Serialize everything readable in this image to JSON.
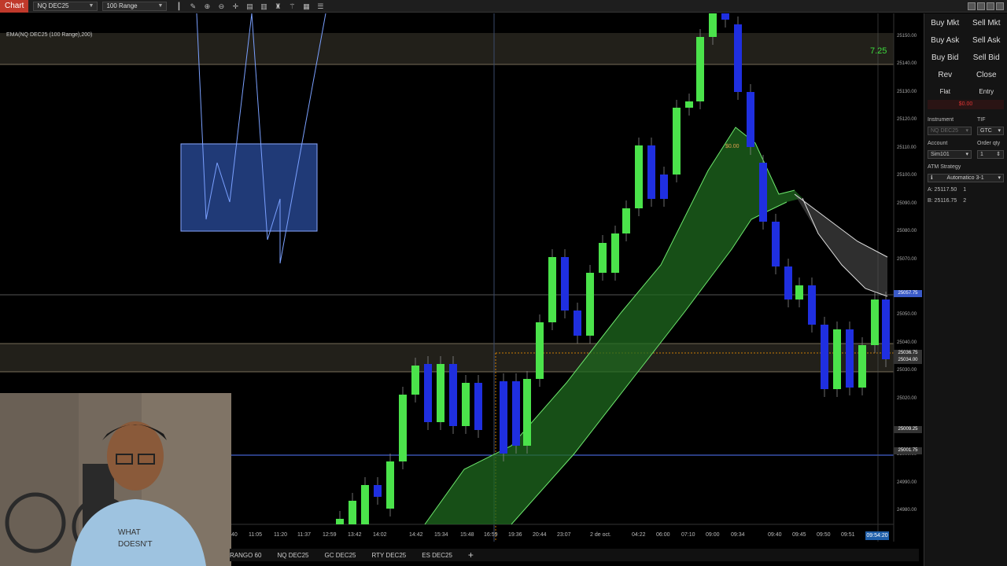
{
  "toolbar": {
    "chart_tab": "Chart",
    "instrument_combo": "NQ DEC25",
    "bar_type_combo": "100 Range",
    "icons": [
      "bar-type-icon",
      "draw-icon",
      "zoom-in-icon",
      "zoom-out-icon",
      "crosshair-icon",
      "properties-icon",
      "templates-icon",
      "strategies-icon",
      "indicators-icon",
      "chart-trader-icon",
      "list-icon"
    ]
  },
  "chart": {
    "indicator_label": "EMA(NQ DEC25 (100 Range),200)",
    "last_tick_countdown": "7.25",
    "price_axis": [
      "25150.00",
      "25140.00",
      "25130.00",
      "25120.00",
      "25110.00",
      "25100.00",
      "25090.00",
      "25080.00",
      "25070.00",
      "25050.00",
      "25040.00",
      "25030.00",
      "25020.00",
      "25000.00",
      "24990.00",
      "24980.00"
    ],
    "price_flags": {
      "current": "25057.75",
      "level_1": "25036.75",
      "level_2": "25034.00",
      "level_3": "25009.25",
      "level_4": "25001.75"
    },
    "time_axis": [
      "40",
      "11:05",
      "11:20",
      "11:37",
      "12:59",
      "13:42",
      "14:02",
      "14:42",
      "15:34",
      "15:48",
      "16:59",
      "19:36",
      "20:44",
      "23:07",
      "2 de oct.",
      "04:22",
      "06:00",
      "07:10",
      "09:00",
      "09:34",
      "09:40",
      "09:45",
      "09:50",
      "09:51"
    ],
    "time_flag": "09:54:20",
    "order_label": "$0.00"
  },
  "bottom_tabs": [
    "RANGO 60",
    "NQ DEC25",
    "GC DEC25",
    "RTY DEC25",
    "ES DEC25"
  ],
  "panel": {
    "buy_mkt": "Buy Mkt",
    "sell_mkt": "Sell Mkt",
    "buy_ask": "Buy Ask",
    "sell_ask": "Sell Ask",
    "buy_bid": "Buy Bid",
    "sell_bid": "Sell Bid",
    "rev": "Rev",
    "close": "Close",
    "flat": "Flat",
    "entry": "Entry",
    "pnl": "$0.00",
    "instrument_label": "Instrument",
    "tif_label": "TIF",
    "instrument_value": "NQ DEC25",
    "tif_value": "GTC",
    "account_label": "Account",
    "order_qty_label": "Order qty",
    "account_value": "Sim101",
    "order_qty_value": "1",
    "atm_label": "ATM Strategy",
    "atm_value": "Automatico 3-1",
    "ask_label": "A: 25117.50",
    "ask_qty": "1",
    "bid_label": "B: 25116.75",
    "bid_qty": "2"
  },
  "colors": {
    "up_candle": "#4be34b",
    "down_candle": "#1f2fe0",
    "ribbon": "#1f6a1f",
    "ribbon_line": "#6ee86e",
    "panel_red": "#d33333",
    "time_flag": "#1f5faa"
  }
}
